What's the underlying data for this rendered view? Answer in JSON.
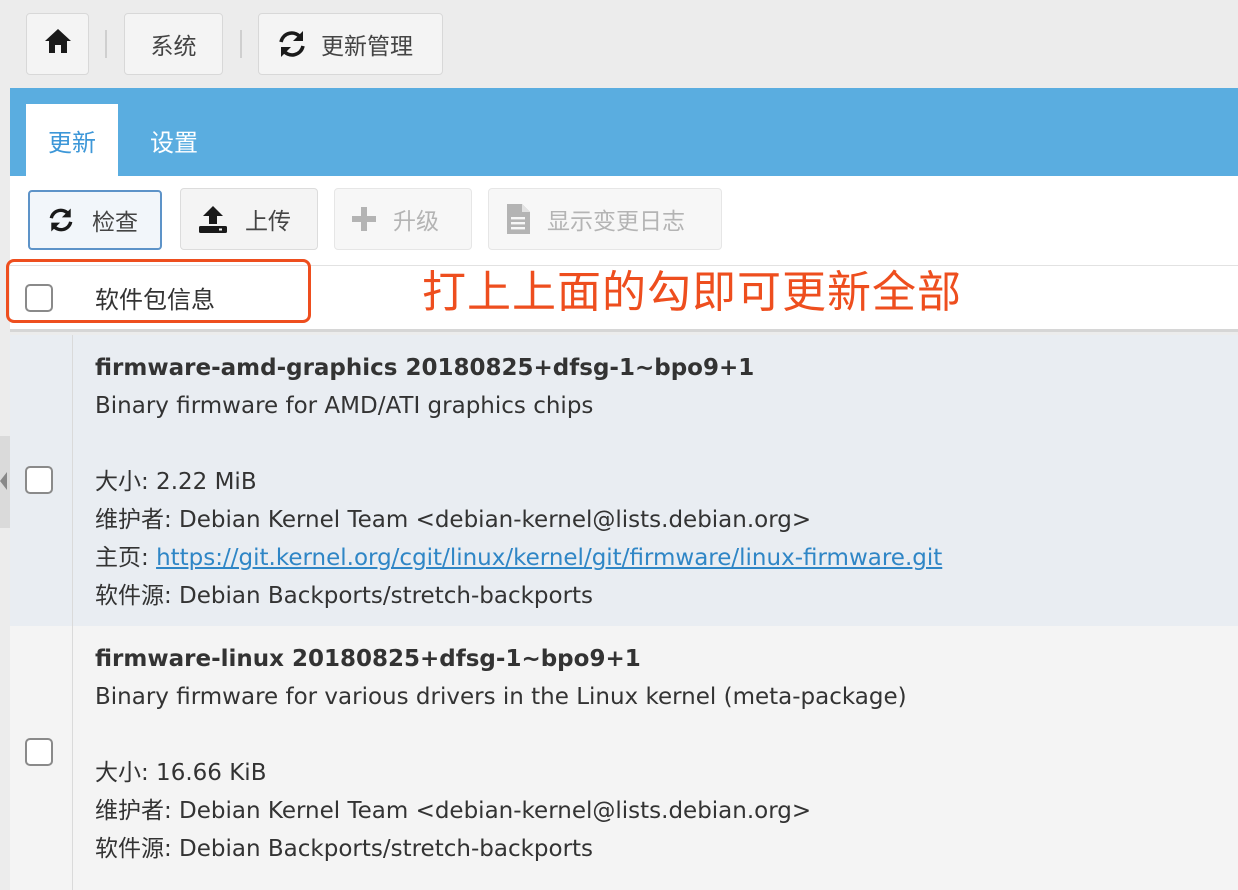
{
  "breadcrumb": {
    "home_icon": "home-icon",
    "system_label": "系统",
    "update_icon": "refresh-icon",
    "update_label": "更新管理"
  },
  "tabs": [
    {
      "label": "更新",
      "active": true
    },
    {
      "label": "设置",
      "active": false
    }
  ],
  "toolbar": {
    "check": {
      "label": "检查",
      "icon": "refresh-icon",
      "enabled": true
    },
    "upload": {
      "label": "上传",
      "icon": "upload-icon",
      "enabled": true
    },
    "upgrade": {
      "label": "升级",
      "icon": "plus-icon",
      "enabled": false
    },
    "changelog": {
      "label": "显示变更日志",
      "icon": "document-icon",
      "enabled": false
    }
  },
  "table": {
    "header_label": "软件包信息",
    "annotation": "打上上面的勾即可更新全部",
    "rows": [
      {
        "name": "firmware-amd-graphics 20180825+dfsg-1~bpo9+1",
        "description": "Binary firmware for AMD/ATI graphics chips",
        "size": "大小: 2.22 MiB",
        "maintainer": "维护者: Debian Kernel Team <debian-kernel@lists.debian.org>",
        "homepage_label": "主页: ",
        "homepage_url": "https://git.kernel.org/cgit/linux/kernel/git/firmware/linux-firmware.git",
        "source": "软件源: Debian Backports/stretch-backports"
      },
      {
        "name": "firmware-linux 20180825+dfsg-1~bpo9+1",
        "description": "Binary firmware for various drivers in the Linux kernel (meta-package)",
        "size": "大小: 16.66 KiB",
        "maintainer": "维护者: Debian Kernel Team <debian-kernel@lists.debian.org>",
        "source": "软件源: Debian Backports/stretch-backports"
      }
    ]
  },
  "colors": {
    "tab_bar": "#5aade0",
    "active_tab_text": "#3d97d8",
    "annotation": "#ee4e1e",
    "link": "#2f86c6"
  }
}
